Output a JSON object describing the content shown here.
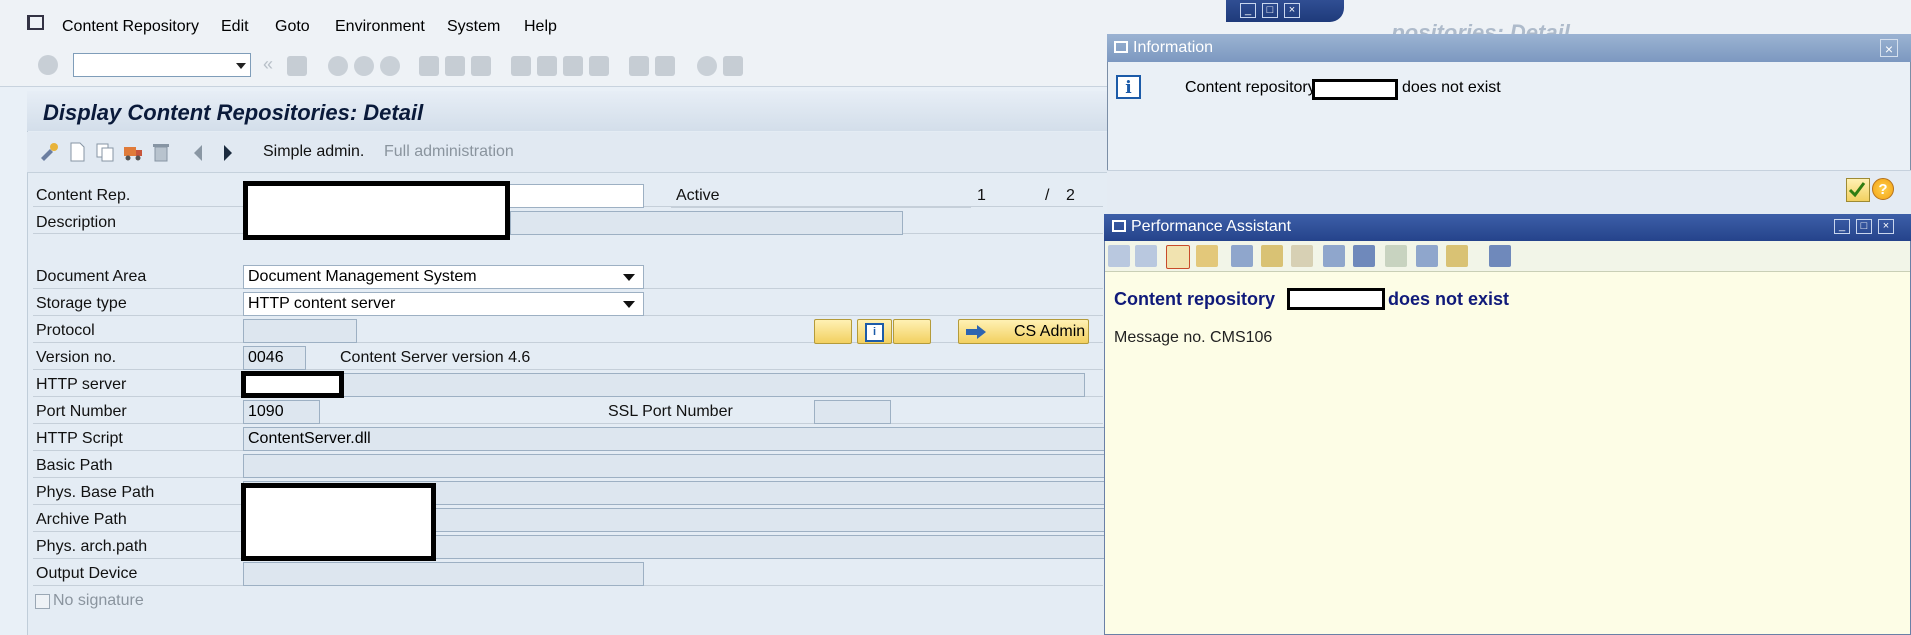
{
  "menu": {
    "items": [
      "Content Repository",
      "Edit",
      "Goto",
      "Environment",
      "System",
      "Help"
    ]
  },
  "window": {
    "title": "Display Content Repositories: Detail",
    "background_title": "...positories: Detail"
  },
  "app_toolbar": {
    "simple_admin": "Simple admin.",
    "full_admin": "Full administration"
  },
  "form": {
    "content_rep_label": "Content Rep.",
    "status": "Active",
    "page_current": "1",
    "page_sep": "/",
    "page_total": "2",
    "description_label": "Description",
    "document_area_label": "Document Area",
    "document_area_value": "Document Management System",
    "storage_type_label": "Storage type",
    "storage_type_value": "HTTP content server",
    "protocol_label": "Protocol",
    "version_label": "Version no.",
    "version_value": "0046",
    "version_text": "Content Server version 4.6",
    "http_server_label": "HTTP server",
    "port_label": "Port Number",
    "port_value": "1090",
    "ssl_port_label": "SSL Port Number",
    "http_script_label": "HTTP Script",
    "http_script_value": "ContentServer.dll",
    "basic_path_label": "Basic Path",
    "phys_base_path_label": "Phys. Base Path",
    "archive_path_label": "Archive Path",
    "phys_arch_path_label": "Phys. arch.path",
    "output_device_label": "Output Device",
    "no_signature_label": "No signature",
    "cs_admin_label": "CS Admin"
  },
  "info_dialog": {
    "title": "Information",
    "message_prefix": "Content repository",
    "message_suffix": "does not exist",
    "icon_glyph": "i",
    "close_glyph": "×",
    "help_glyph": "?"
  },
  "performance_assistant": {
    "title": "Performance Assistant",
    "heading_prefix": "Content repository",
    "heading_suffix": "does not exist",
    "message_no": "Message no. CMS106"
  },
  "colors": {
    "sap_blue": "#25438b",
    "form_bg": "#e4ecf4",
    "pa_bg": "#fdfde6",
    "button_gold": "#f2d060"
  },
  "icons": [
    "menu-icon",
    "check-icon",
    "save-icon",
    "back-icon",
    "exit-icon",
    "cancel-icon",
    "print-icon",
    "find-icon",
    "find-next-icon",
    "first-page-icon",
    "prev-page-icon",
    "next-page-icon",
    "last-page-icon",
    "new-session-icon",
    "shortcut-icon",
    "help-icon",
    "customize-icon",
    "info-icon"
  ]
}
